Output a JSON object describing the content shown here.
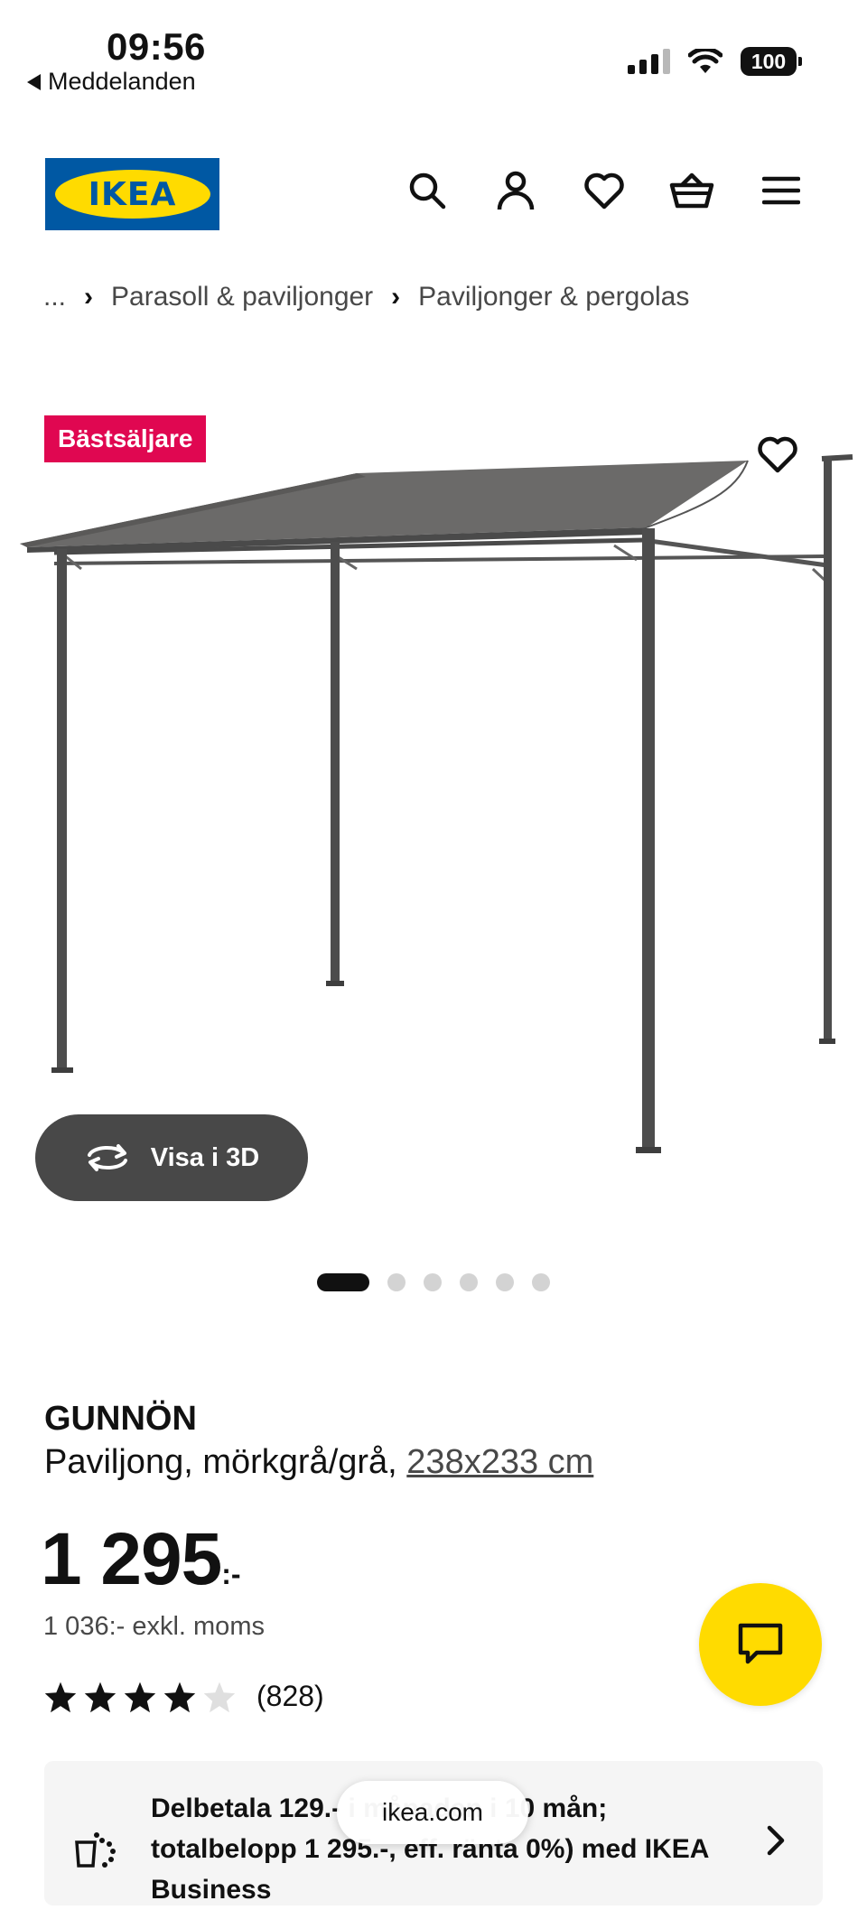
{
  "status_bar": {
    "time": "09:56",
    "back_label": "Meddelanden",
    "battery": "100"
  },
  "header": {
    "logo_text": "IKEA",
    "brand_colors": {
      "blue": "#0058a3",
      "yellow": "#ffdb00"
    },
    "icons": [
      "search-icon",
      "account-icon",
      "heart-icon",
      "basket-icon",
      "menu-icon"
    ]
  },
  "breadcrumb": {
    "ellipsis": "...",
    "items": [
      "Parasoll & paviljonger",
      "Paviljonger & pergolas"
    ]
  },
  "product": {
    "badge": "Bästsäljare",
    "badge_color": "#e00751",
    "view_3d_label": "Visa i 3D",
    "carousel": {
      "total": 6,
      "active": 1
    },
    "name": "GUNNÖN",
    "description": "Paviljong, mörkgrå/grå,",
    "size": "238x233 cm",
    "price": "1 295",
    "price_suffix": ":-",
    "price_excl_vat": "1 036:- exkl. moms",
    "rating": {
      "value": 4,
      "max": 5,
      "count": "(828)"
    }
  },
  "installment": {
    "text": "Delbetala 129.- i månaden i 10 mån; totalbelopp 1 295.-, eff. ränta 0%) med IKEA Business"
  },
  "browser": {
    "url": "ikea.com"
  }
}
